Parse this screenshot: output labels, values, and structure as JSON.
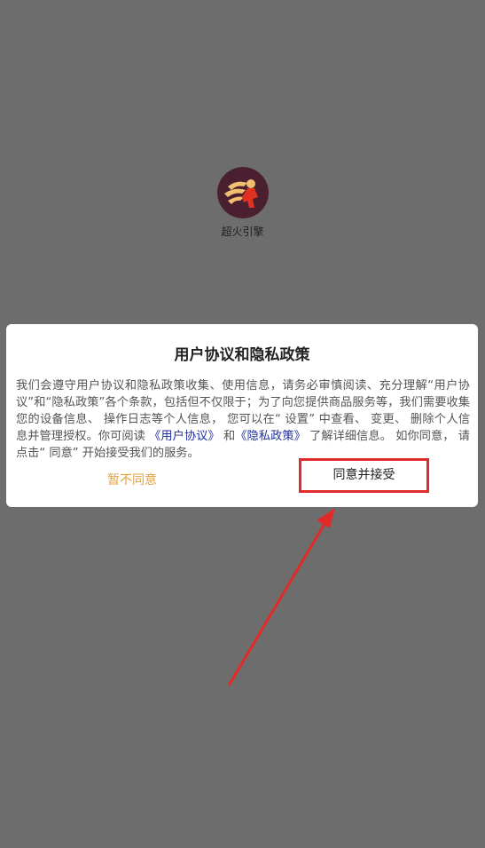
{
  "app": {
    "name": "超火引擎"
  },
  "dialog": {
    "title": "用户协议和隐私政策",
    "body_part1": "我们会遵守用户协议和隐私政策收集、使用信息，请务必审慎阅读、充分理解“用户协议”和“隐私政策”各个条款，包括但不仅限于；为了向您提供商品服务等，我们需要收集您的设备信息、 操作日志等个人信息， 您可以在“ 设置” 中查看、 变更、 删除个人信息并管理授权。你可阅读 ",
    "user_agreement_link": "《用户协议》",
    "and_text": " 和",
    "privacy_policy_link": "《隐私政策》",
    "body_part2": " 了解详细信息。 如你同意， 请点击“ 同意” 开始接受我们的服务。",
    "disagree_label": "暂不同意",
    "agree_label": "同意并接受"
  },
  "colors": {
    "overlay": "#6d6d6d",
    "dialog_bg": "#ffffff",
    "link": "#1f2fa0",
    "disagree": "#e3a13e",
    "highlight_annotation": "#e32a2a"
  }
}
